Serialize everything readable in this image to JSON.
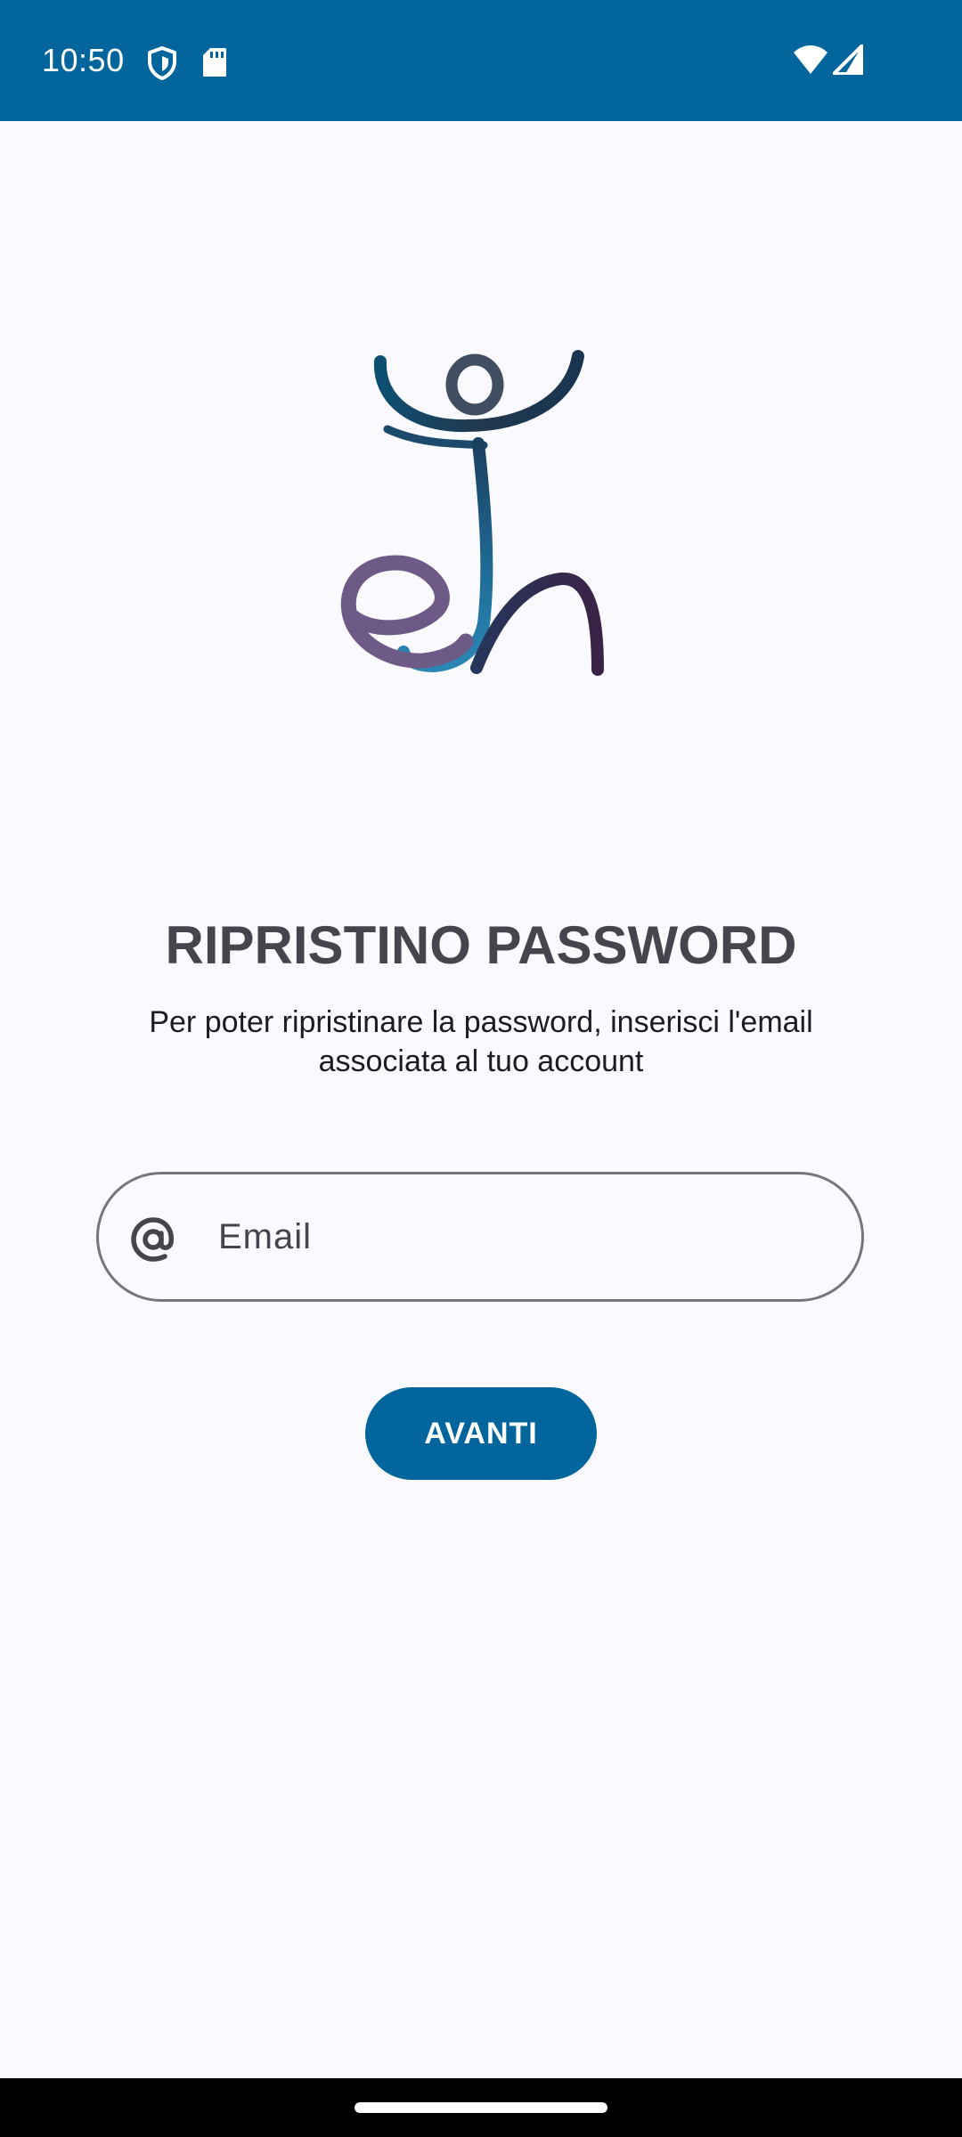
{
  "status_bar": {
    "time": "10:50",
    "background_color": "#02659b",
    "icons": [
      "shield-icon",
      "sd-card-icon",
      "wifi-icon",
      "cell-signal-icon"
    ]
  },
  "logo": {
    "icon": "eh-logo-figure"
  },
  "page": {
    "title": "RIPRISTINO PASSWORD",
    "subtitle": "Per poter ripristinare la password, inserisci l'email associata al tuo account"
  },
  "form": {
    "email_placeholder": "Email",
    "email_value": "",
    "email_icon": "at-icon",
    "submit_label": "AVANTI"
  },
  "colors": {
    "accent": "#02659b",
    "background": "#faf9fd",
    "title_text": "#45454d",
    "outline": "#76767a"
  }
}
